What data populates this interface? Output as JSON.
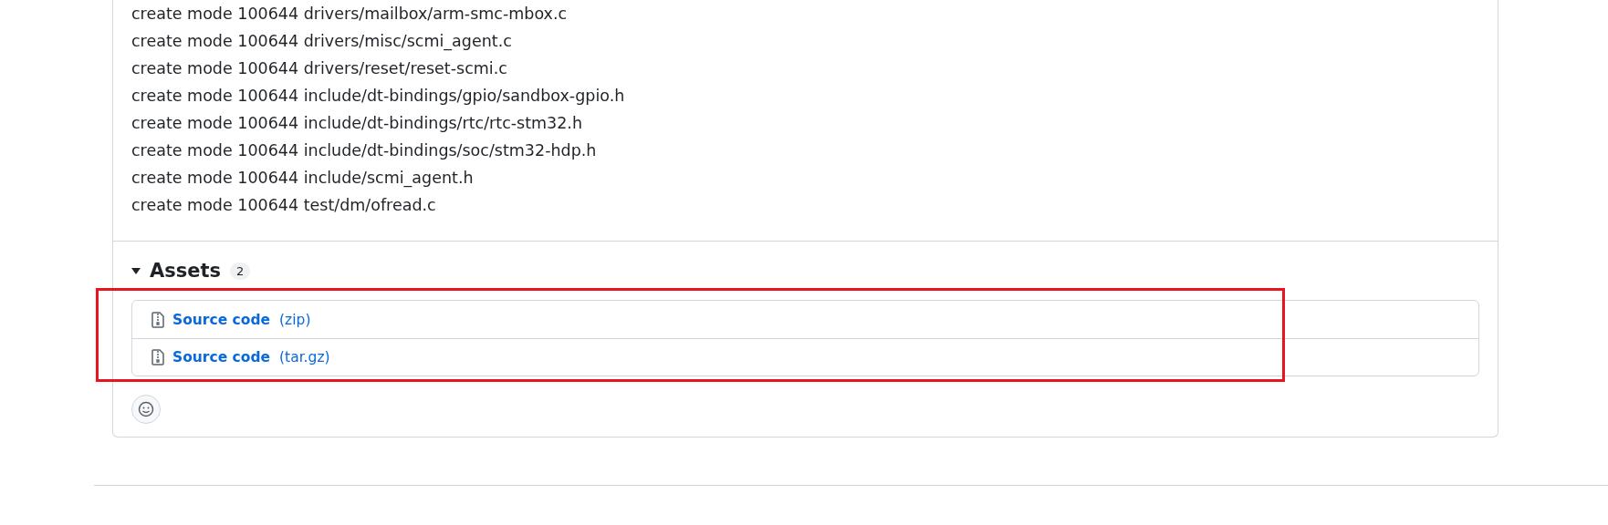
{
  "commit_output": [
    "create mode 100644 drivers/mailbox/arm-smc-mbox.c",
    "create mode 100644 drivers/misc/scmi_agent.c",
    "create mode 100644 drivers/reset/reset-scmi.c",
    "create mode 100644 include/dt-bindings/gpio/sandbox-gpio.h",
    "create mode 100644 include/dt-bindings/rtc/rtc-stm32.h",
    "create mode 100644 include/dt-bindings/soc/stm32-hdp.h",
    "create mode 100644 include/scmi_agent.h",
    "create mode 100644 test/dm/ofread.c"
  ],
  "assets": {
    "title": "Assets",
    "count": "2",
    "expanded": true,
    "highlighted": true,
    "items": [
      {
        "label": "Source code",
        "format": "(zip)"
      },
      {
        "label": "Source code",
        "format": "(tar.gz)"
      }
    ]
  }
}
